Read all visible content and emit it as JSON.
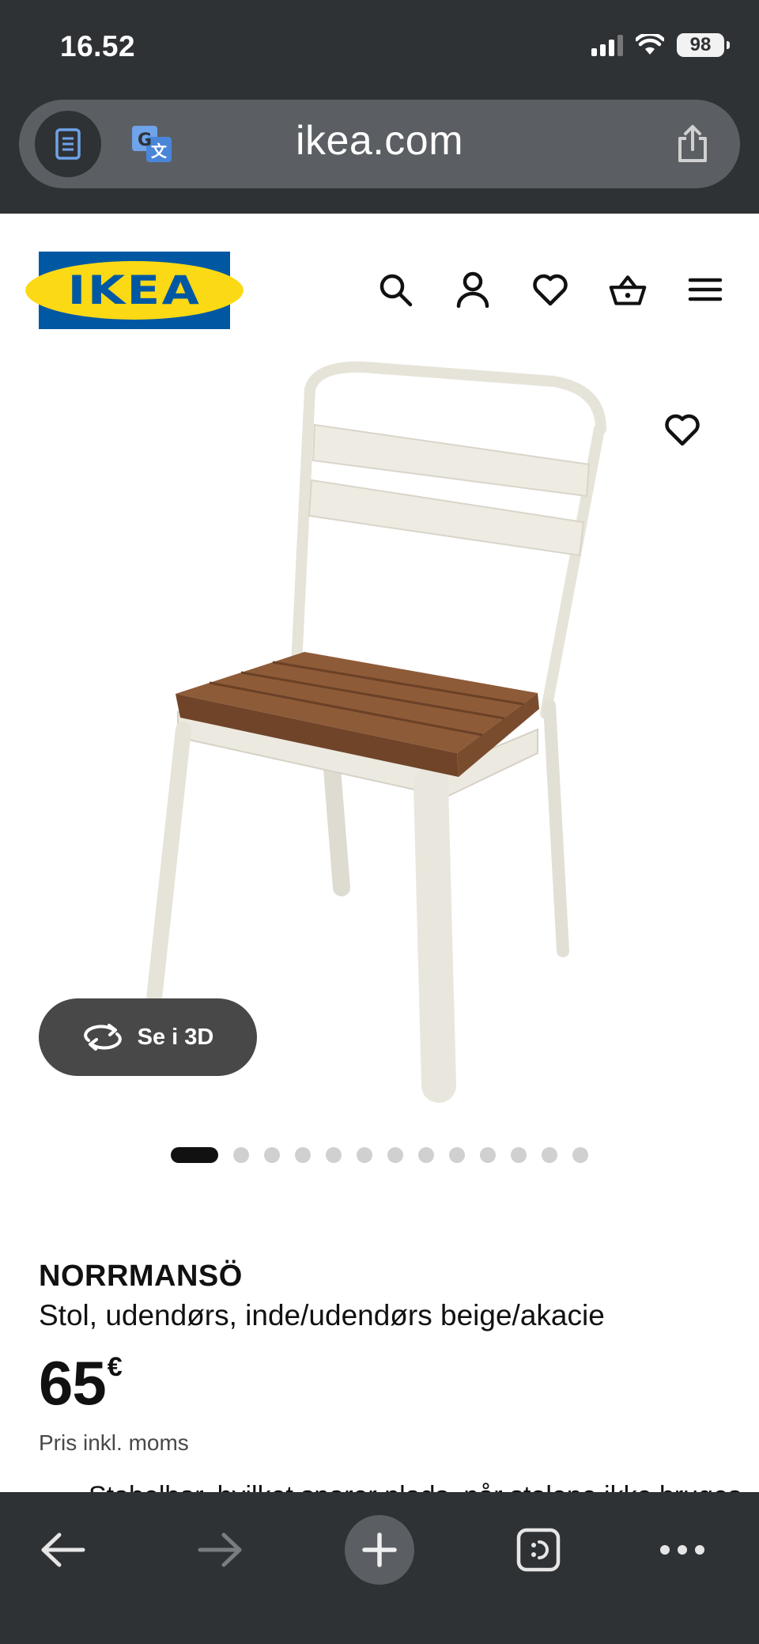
{
  "status_bar": {
    "time": "16.52",
    "battery": "98",
    "icons": [
      "cellular-signal-icon",
      "wifi-icon",
      "battery-icon"
    ]
  },
  "browser": {
    "url": "ikea.com",
    "buttons": [
      "reader-mode-icon",
      "translate-icon",
      "share-icon"
    ],
    "toolbar": [
      "back-arrow-icon",
      "forward-arrow-icon",
      "new-tab-plus-icon",
      "tabs-icon",
      "more-icon"
    ]
  },
  "header": {
    "logo_text": "IKEA",
    "nav_icons": [
      "search-icon",
      "account-icon",
      "favourites-heart-icon",
      "basket-icon",
      "menu-icon"
    ]
  },
  "gallery": {
    "view_3d_label": "Se i 3D",
    "image_count": 13,
    "active_index": 0
  },
  "product": {
    "name": "NORRMANSÖ",
    "description": "Stol, udendørs, inde/udendørs beige/akacie",
    "price_integer": "65",
    "price_currency": "€",
    "vat_note": "Pris inkl. moms",
    "partial_text": "Stabelbar, hvilket sparer plads, når stolene ikke bruges"
  },
  "colors": {
    "browser_chrome": "#2f3235",
    "url_bar": "#5b5f63",
    "ikea_blue": "#0058a3",
    "ikea_yellow": "#fbd914",
    "text_primary": "#111111",
    "button_dark": "#484848"
  }
}
